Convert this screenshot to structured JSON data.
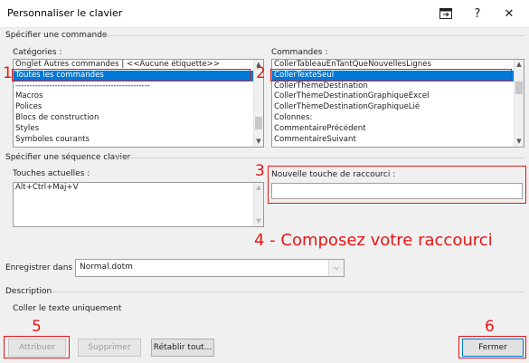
{
  "window": {
    "title": "Personnaliser le clavier",
    "help_glyph": "?",
    "close_glyph": "✕"
  },
  "section_command": "Spécifier une commande",
  "categories": {
    "label": "Catégories :",
    "items": [
      "Onglet Autres commandes | <<Aucune étiquette>>",
      "Toutes les commandes",
      "------------------------------------------------",
      "Macros",
      "Polices",
      "Blocs de construction",
      "Styles",
      "Symboles courants"
    ],
    "selected_index": 1
  },
  "commands": {
    "label": "Commandes :",
    "items": [
      "CollerTableauEnTantQueNouvellesLignes",
      "CollerTexteSeul",
      "CollerThèmeDestination",
      "CollerThèmeDestinationGraphiqueExcel",
      "CollerThèmeDestinationGraphiqueLié",
      "Colonnes:",
      "CommentairePrécédent",
      "CommentaireSuivant"
    ],
    "selected_index": 1
  },
  "section_key": "Spécifier une séquence clavier",
  "current_keys": {
    "label": "Touches actuelles :",
    "items": [
      "Alt+Ctrl+Maj+V"
    ]
  },
  "new_shortcut": {
    "label": "Nouvelle touche de raccourci :",
    "value": ""
  },
  "annotations": {
    "n1": "1",
    "n2": "2",
    "n3": "3",
    "n4": "4 - Composez votre raccourci",
    "n5": "5",
    "n6": "6",
    "color": "#e81515"
  },
  "save_in": {
    "label": "Enregistrer dans :",
    "value": "Normal.dotm"
  },
  "description": {
    "heading": "Description",
    "text": "Coller le texte uniquement"
  },
  "buttons": {
    "assign": "Attribuer",
    "remove": "Supprimer",
    "reset": "Rétablir tout...",
    "close": "Fermer"
  },
  "colors": {
    "selection": "#0078d7",
    "annotation": "#e81515",
    "dialog_bg": "#f0f0f0"
  }
}
